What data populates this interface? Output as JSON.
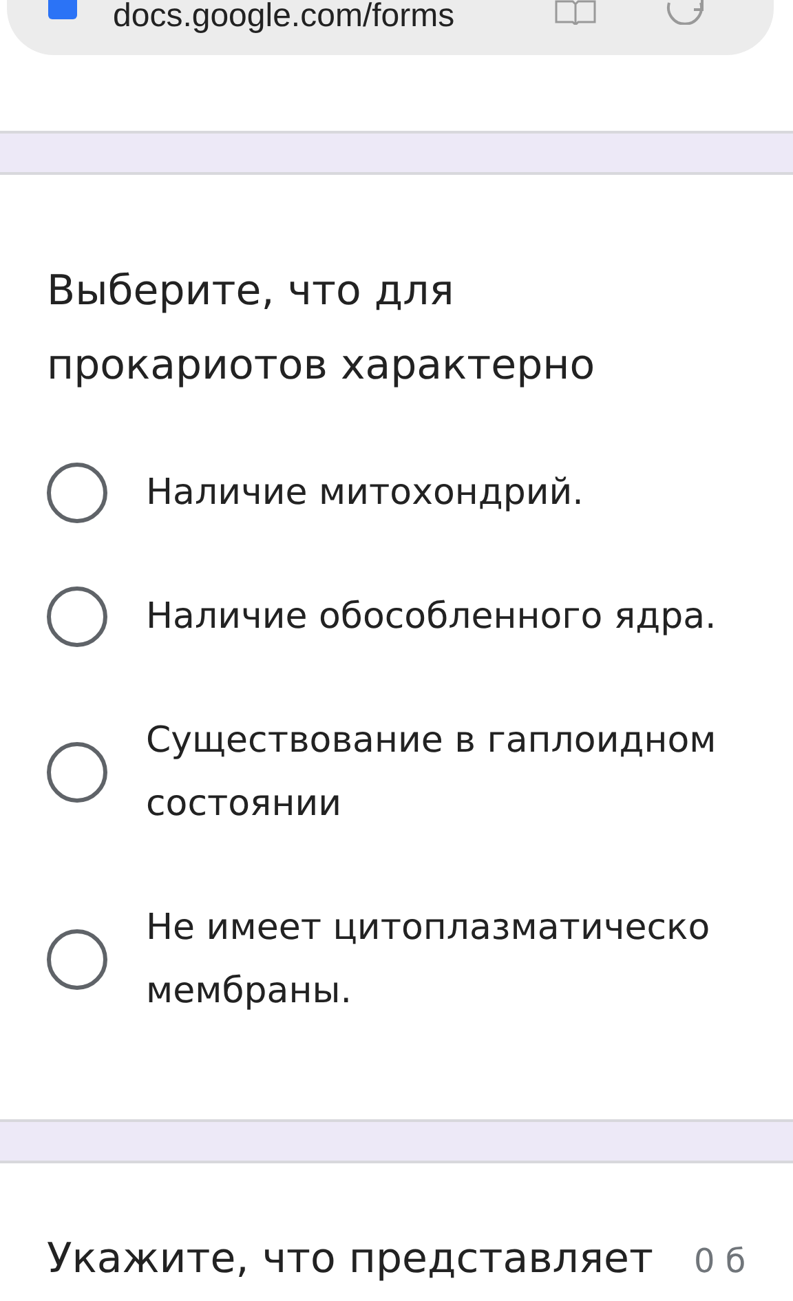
{
  "address_bar": {
    "url": "docs.google.com/forms"
  },
  "question": {
    "title": "Выберите, что для прокариотов характерно",
    "options": [
      {
        "label": "Наличие митохондрий.",
        "selected": false
      },
      {
        "label": "Наличие обособленного ядра.",
        "selected": false
      },
      {
        "label": "Существование в гаплоидном состоянии",
        "selected": false
      },
      {
        "label": "Не имеет цитоплазматическо мембраны.",
        "selected": false
      }
    ]
  },
  "next_question": {
    "title": "Укажите, что представляет",
    "points": "0 б"
  }
}
